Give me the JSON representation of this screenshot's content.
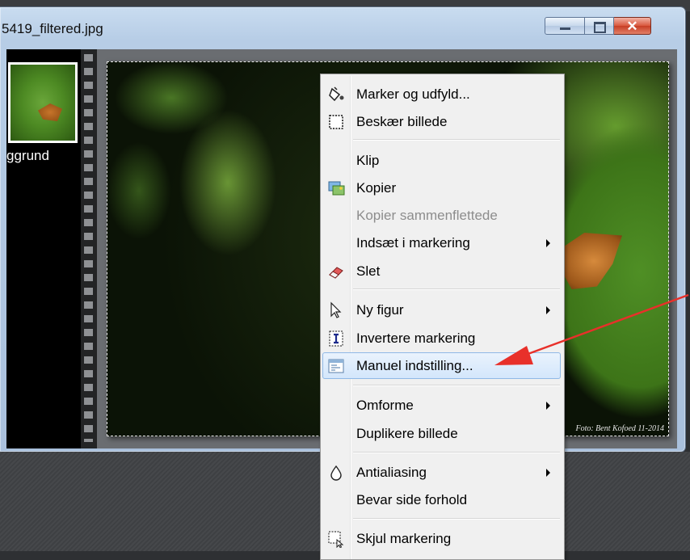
{
  "window": {
    "title": "5419_filtered.jpg",
    "buttons": {
      "minimize": "minimize",
      "maximize": "maximize",
      "close": "✕"
    }
  },
  "thumbnail": {
    "label": "ggrund"
  },
  "photo": {
    "credit": "Foto: Bent Kofoed 11-2014"
  },
  "context_menu": {
    "items": [
      {
        "label": "Marker og udfyld...",
        "icon": "paint-bucket-icon"
      },
      {
        "label": "Beskær billede",
        "icon": "crop-icon"
      },
      {
        "label": "Klip"
      },
      {
        "label": "Kopier",
        "icon": "copy-image-icon"
      },
      {
        "label": "Kopier sammenflettede",
        "disabled": true
      },
      {
        "label": "Indsæt i markering",
        "submenu": true
      },
      {
        "label": "Slet",
        "icon": "eraser-icon"
      },
      {
        "label": "Ny figur",
        "icon": "pointer-icon",
        "submenu": true
      },
      {
        "label": "Invertere markering",
        "icon": "invert-selection-icon"
      },
      {
        "label": "Manuel indstilling...",
        "icon": "window-settings-icon",
        "highlighted": true
      },
      {
        "label": "Omforme",
        "submenu": true
      },
      {
        "label": "Duplikere billede"
      },
      {
        "label": "Antialiasing",
        "icon": "droplet-icon",
        "submenu": true
      },
      {
        "label": "Bevar side forhold"
      },
      {
        "label": "Skjul markering",
        "icon": "hide-selection-icon"
      }
    ]
  },
  "colors": {
    "annotation_arrow": "#e8302a",
    "menu_highlight": "#d3e6fb"
  }
}
